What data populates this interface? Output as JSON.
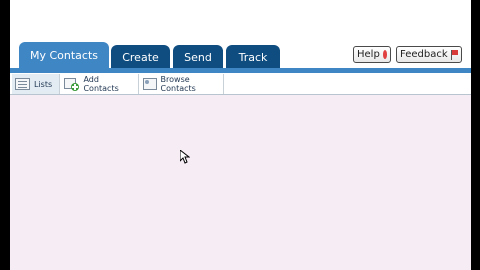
{
  "tabs": [
    {
      "label": "My Contacts",
      "active": true
    },
    {
      "label": "Create",
      "active": false
    },
    {
      "label": "Send",
      "active": false
    },
    {
      "label": "Track",
      "active": false
    }
  ],
  "top_buttons": {
    "help_label": "Help",
    "feedback_label": "Feedback"
  },
  "subnav": {
    "items": [
      {
        "label": "Lists",
        "icon": "list-icon",
        "active": true
      },
      {
        "label": "Add Contacts",
        "icon": "add-contact-icon",
        "active": false
      },
      {
        "label": "Browse Contacts",
        "icon": "browse-contacts-icon",
        "active": false
      }
    ]
  },
  "colors": {
    "tab_dark": "#0f4d80",
    "tab_active": "#3f86c4",
    "content_bg": "#f5ecf4"
  }
}
